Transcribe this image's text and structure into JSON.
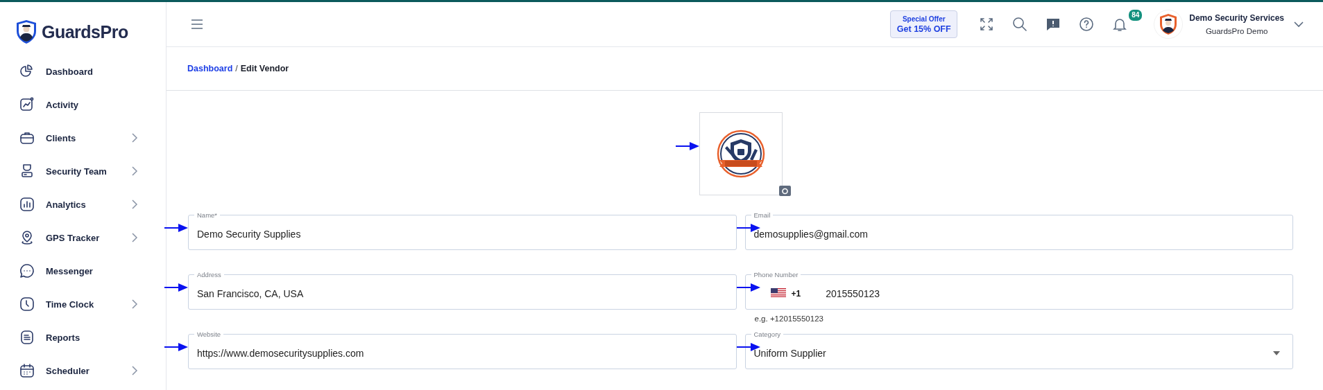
{
  "brand": {
    "name": "GuardsPro"
  },
  "sidebar": {
    "items": [
      {
        "label": "Dashboard",
        "has_submenu": false
      },
      {
        "label": "Activity",
        "has_submenu": false
      },
      {
        "label": "Clients",
        "has_submenu": true
      },
      {
        "label": "Security Team",
        "has_submenu": true
      },
      {
        "label": "Analytics",
        "has_submenu": true
      },
      {
        "label": "GPS Tracker",
        "has_submenu": true
      },
      {
        "label": "Messenger",
        "has_submenu": false
      },
      {
        "label": "Time Clock",
        "has_submenu": true
      },
      {
        "label": "Reports",
        "has_submenu": false
      },
      {
        "label": "Scheduler",
        "has_submenu": true
      }
    ]
  },
  "header": {
    "offer": {
      "line_1": "Special Offer",
      "line_2": "Get 15% OFF"
    },
    "notifications": {
      "count": "84"
    },
    "account": {
      "name": "Demo Security Services",
      "subtitle": "GuardsPro Demo"
    }
  },
  "breadcrumb": {
    "items": [
      {
        "label": "Dashboard",
        "kind": "link"
      },
      {
        "label": "Edit Vendor",
        "kind": "current"
      }
    ],
    "separator": "/"
  },
  "logo_upload": {
    "kind": "picture",
    "annotated": true
  },
  "fields": [
    {
      "kind": "text",
      "label": "Name*",
      "value": "Demo Security Supplies",
      "annotated": true
    },
    {
      "kind": "text",
      "label": "Email",
      "value": "demosupplies@gmail.com",
      "annotated": true
    },
    {
      "kind": "text",
      "label": "Address",
      "value": "San Francisco, CA, USA",
      "annotated": true
    },
    {
      "kind": "phone",
      "label": "Phone Number",
      "country_code": "+1",
      "value": "2015550123",
      "helper": "e.g. +12015550123",
      "annotated": true
    },
    {
      "kind": "text",
      "label": "Website",
      "value": "https://www.demosecuritysupplies.com",
      "annotated": true
    },
    {
      "kind": "select",
      "label": "Category",
      "value": "Uniform Supplier",
      "annotated": true
    }
  ]
}
